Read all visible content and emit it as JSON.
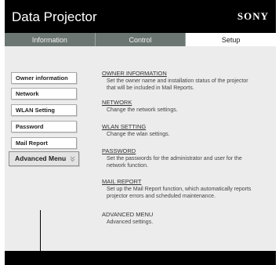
{
  "header": {
    "title": "Data Projector",
    "brand": "SONY"
  },
  "tabs": [
    {
      "label": "Information",
      "active": false
    },
    {
      "label": "Control",
      "active": false
    },
    {
      "label": "Setup",
      "active": true
    }
  ],
  "sidebar": {
    "items": [
      {
        "label": "Owner information"
      },
      {
        "label": "Network"
      },
      {
        "label": "WLAN Setting"
      },
      {
        "label": "Password"
      },
      {
        "label": "Mail Report"
      },
      {
        "label": "Advanced Menu",
        "icon": "chevron-double-down-icon"
      }
    ]
  },
  "main": {
    "items": [
      {
        "title": "OWNER INFORMATION",
        "desc1": "Set the owner name and installation status of the projector",
        "desc2": "that will be included in Mail Reports."
      },
      {
        "title": "NETWORK",
        "desc1": "Change the network settings.",
        "desc2": ""
      },
      {
        "title": "WLAN SETTING",
        "desc1": "Change the wlan settings.",
        "desc2": ""
      },
      {
        "title": "PASSWORD",
        "desc1": "Set the passwords for the administrator and user for the",
        "desc2": "network function."
      },
      {
        "title": "MAIL REPORT",
        "desc1": "Set up the Mail Report function, which automatically reports",
        "desc2": "projector errors and scheduled maintenance."
      },
      {
        "title": "ADVANCED MENU",
        "desc1": "Advanced settings.",
        "desc2": ""
      }
    ]
  },
  "colors": {
    "header_bg": "#000000",
    "tab_bg": "#6b7672",
    "content_bg": "#ececec"
  }
}
